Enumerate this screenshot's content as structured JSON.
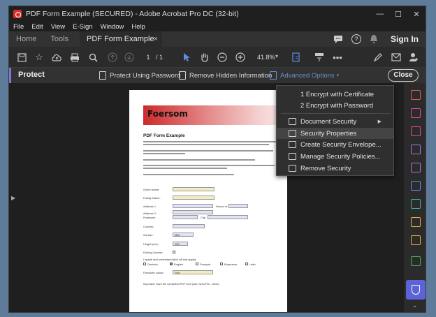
{
  "window": {
    "title": "PDF Form Example (SECURED) - Adobe Acrobat Pro DC (32-bit)",
    "minimize": "—",
    "maximize": "☐",
    "close": "✕"
  },
  "menubar": [
    "File",
    "Edit",
    "View",
    "E-Sign",
    "Window",
    "Help"
  ],
  "tabs": {
    "home": "Home",
    "tools": "Tools",
    "document": "PDF Form Example ...",
    "close_tab": "×",
    "sign_in": "Sign In"
  },
  "toolbar": {
    "page_current": "1",
    "page_total": "/ 1",
    "zoom": "41.8%"
  },
  "protect": {
    "title": "Protect",
    "protect_using_password": "Protect Using Password",
    "remove_hidden_information": "Remove Hidden Information",
    "advanced_options": "Advanced Options",
    "close": "Close"
  },
  "dropdown": {
    "items": [
      "1 Encrypt with Certificate",
      "2 Encrypt with Password",
      "Document Security",
      "Security Properties",
      "Create Security Envelope...",
      "Manage Security Policies...",
      "Remove Security"
    ]
  },
  "pdf": {
    "banner": "Foersom",
    "title": "PDF Form Example",
    "labels": {
      "given_name": "Given Name:",
      "family_name": "Family Name:",
      "address1": "Address 1:",
      "house_nr": "House nr:",
      "address2": "Address 2:",
      "postcode": "Postcode:",
      "city": "City:",
      "country": "Country:",
      "gender": "Gender:",
      "gender_value": "Man",
      "height": "Height (cm):",
      "height_value": "150",
      "driving_license": "Driving License:",
      "languages": "I speak and understand (tick all that apply):",
      "deutsch": "Deutsch",
      "english": "English",
      "francais": "Français",
      "esperanto": "Esperanto",
      "latin": "Latin",
      "favourite_colour": "Favourite colour:",
      "favourite_value": "Red",
      "important": "Important: Save the completed PDF form (use menu File - Save)."
    }
  },
  "colors": {
    "accent": "#5b63d6",
    "protect_bar_accent": "#7b76d8",
    "advanced_options_text": "#6a8ec9"
  }
}
